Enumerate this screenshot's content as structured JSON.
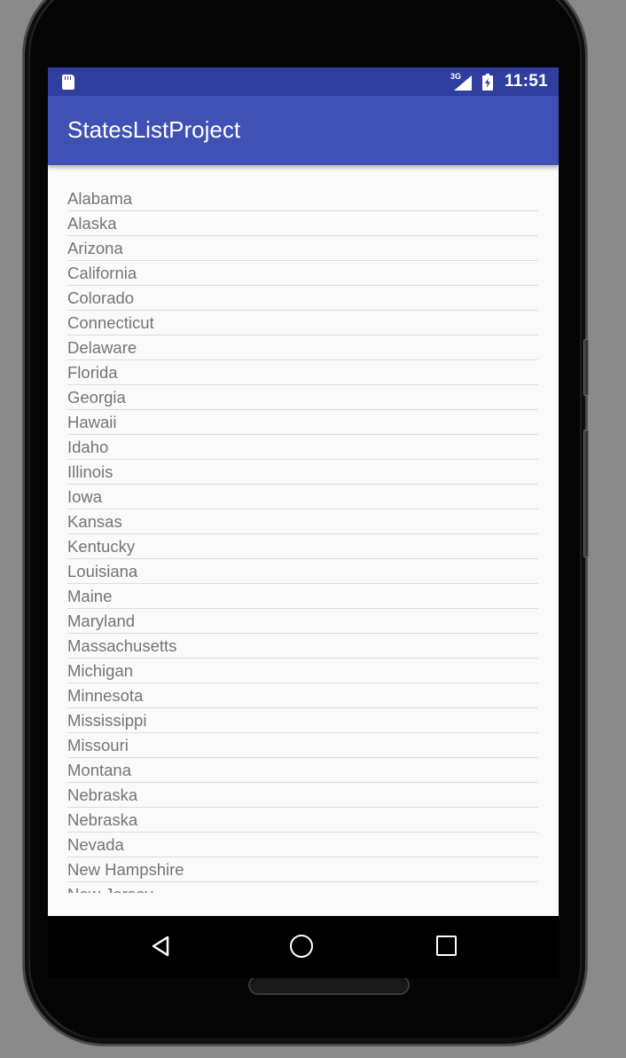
{
  "status_bar": {
    "network_label": "3G",
    "time": "11:51",
    "left_icon": "sd-card-icon",
    "signal_icon": "cell-signal-icon",
    "battery_icon": "battery-charging-icon",
    "color": "#303f9f"
  },
  "app_bar": {
    "title": "StatesListProject",
    "color": "#3f51b5"
  },
  "states_list": {
    "items": [
      "Alabama",
      "Alaska",
      "Arizona",
      "California",
      "Colorado",
      "Connecticut",
      "Delaware",
      "Florida",
      "Georgia",
      "Hawaii",
      "Idaho",
      "Illinois",
      "Iowa",
      "Kansas",
      "Kentucky",
      "Louisiana",
      "Maine",
      "Maryland",
      "Massachusetts",
      "Michigan",
      "Minnesota",
      "Mississippi",
      "Missouri",
      "Montana",
      "Nebraska",
      "Nebraska",
      "Nevada",
      "New Hampshire",
      "New Jersey"
    ]
  },
  "nav_bar": {
    "back_icon": "back-triangle-icon",
    "home_icon": "home-circle-icon",
    "recents_icon": "recents-square-icon"
  }
}
